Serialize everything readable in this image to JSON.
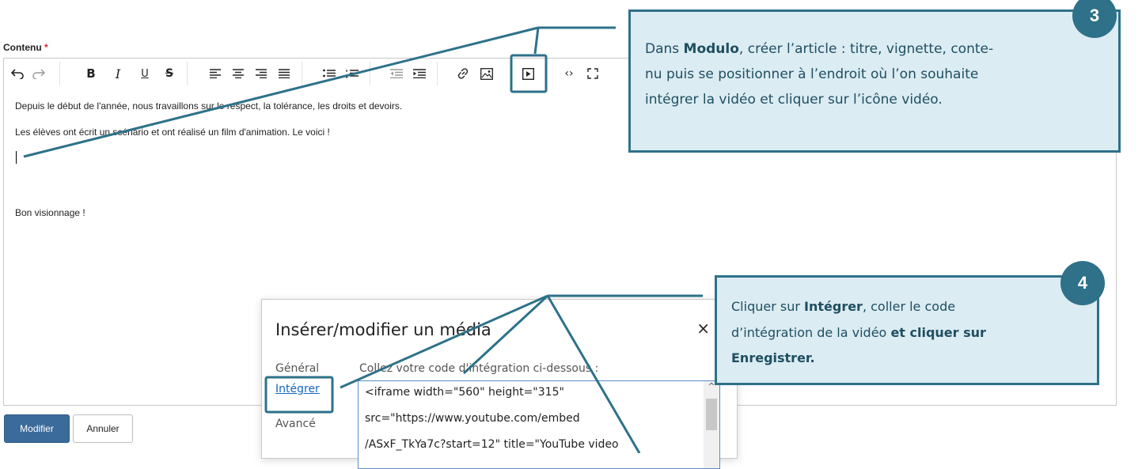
{
  "form": {
    "field_label": "Contenu",
    "required_mark": "*"
  },
  "toolbar": {
    "items": [
      "undo-icon",
      "redo-icon",
      "bold-icon",
      "italic-icon",
      "underline-icon",
      "strikethrough-icon",
      "align-left-icon",
      "align-center-icon",
      "align-right-icon",
      "align-justify-icon",
      "bullet-list-icon",
      "numbered-list-icon",
      "outdent-icon",
      "indent-icon",
      "link-icon",
      "image-icon",
      "media-icon",
      "source-code-icon",
      "fullscreen-icon"
    ]
  },
  "editor": {
    "lines": [
      "Depuis le début de l'année, nous travaillons sur le respect, la tolérance, les droits et devoirs.",
      "Les élèves ont écrit un scénario et ont réalisé un film d'animation. Le voici !",
      "Bon visionnage !"
    ]
  },
  "buttons": {
    "modify": "Modifier",
    "cancel": "Annuler"
  },
  "dialog": {
    "title": "Insérer/modifier un média",
    "close": "×",
    "nav": [
      "Général",
      "Intégrer",
      "Avancé"
    ],
    "instructions": "Collez votre code d'intégration ci-dessous :",
    "code_lines": [
      "<iframe width=\"560\" height=\"315\"",
      "src=\"https://www.youtube.com/embed",
      "/ASxF_TkYa7c?start=12\" title=\"YouTube video"
    ]
  },
  "callouts": {
    "step3": {
      "badge": "3",
      "lines": [
        [
          "Dans ",
          "Modulo",
          ", créer l’article : titre, vignette, conte-"
        ],
        [
          "nu puis se positionner à l’endroit où l’on souhaite"
        ],
        [
          "intégrer la vidéo et  cliquer sur l’icône vidéo."
        ]
      ]
    },
    "step4": {
      "badge": "4",
      "lines": [
        [
          "Cliquer sur ",
          "Intégrer",
          ", coller le code"
        ],
        [
          "d’intégration de la vidéo ",
          "et cliquer sur",
          ""
        ],
        [
          "",
          "Enregistrer.",
          ""
        ]
      ]
    }
  },
  "colors": {
    "callout_border": "#2e7189",
    "callout_fill": "#dbecf2",
    "primary_button": "#3b6b9a",
    "link": "#1565c0"
  }
}
